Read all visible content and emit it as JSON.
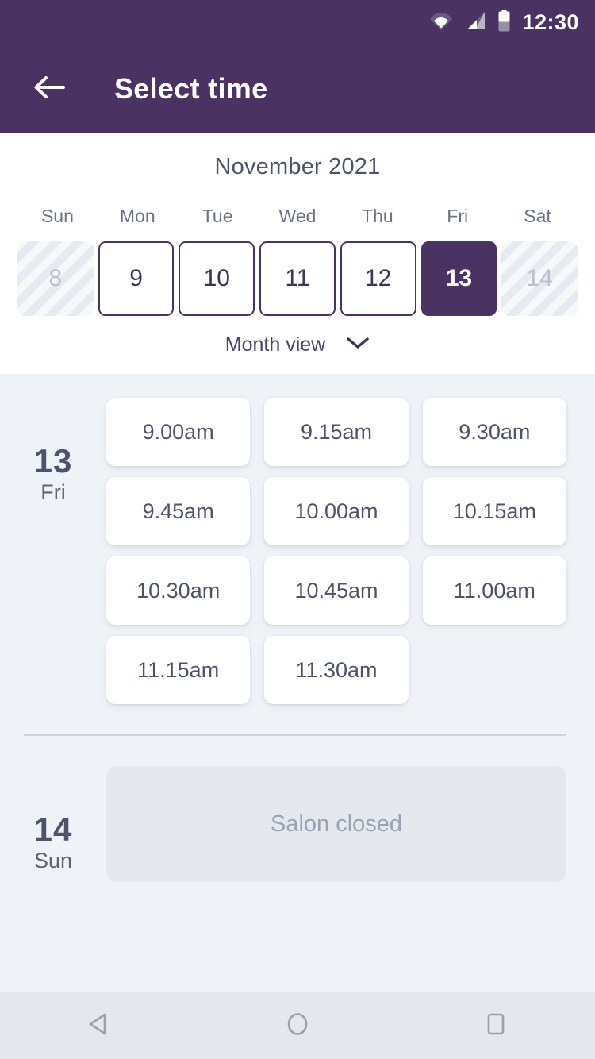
{
  "statusbar": {
    "time": "12:30",
    "icons": [
      "wifi-icon",
      "cellular-signal-icon",
      "battery-icon"
    ]
  },
  "appbar": {
    "back_label": "back-arrow",
    "title": "Select time"
  },
  "calendar": {
    "month_title": "November 2021",
    "weekdays": [
      "Sun",
      "Mon",
      "Tue",
      "Wed",
      "Thu",
      "Fri",
      "Sat"
    ],
    "days": [
      {
        "num": "8",
        "state": "disabled"
      },
      {
        "num": "9",
        "state": "normal"
      },
      {
        "num": "10",
        "state": "normal"
      },
      {
        "num": "11",
        "state": "normal"
      },
      {
        "num": "12",
        "state": "normal"
      },
      {
        "num": "13",
        "state": "selected"
      },
      {
        "num": "14",
        "state": "disabled"
      }
    ],
    "view_toggle_label": "Month view",
    "view_toggle_icon": "chevron-down-icon"
  },
  "schedule": [
    {
      "day_num": "13",
      "day_name": "Fri",
      "slots": [
        "9.00am",
        "9.15am",
        "9.30am",
        "9.45am",
        "10.00am",
        "10.15am",
        "10.30am",
        "10.45am",
        "11.00am",
        "11.15am",
        "11.30am"
      ]
    },
    {
      "day_num": "14",
      "day_name": "Sun",
      "closed_label": "Salon closed"
    }
  ],
  "navbar": {
    "back": "android-back-icon",
    "home": "android-home-icon",
    "recents": "android-recents-icon"
  },
  "colors": {
    "brand_purple": "#4a3263",
    "page_bg": "#eff2f7",
    "slot_text": "#4b5468",
    "closed_bg": "#e5e9ee"
  }
}
